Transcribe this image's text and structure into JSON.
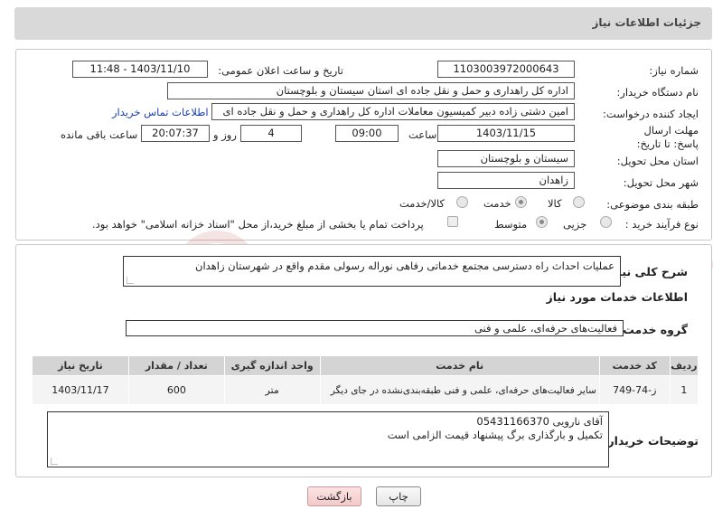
{
  "header": {
    "title": "جزئیات اطلاعات نیاز"
  },
  "form": {
    "need_number": {
      "label": "شماره نیاز:",
      "value": "1103003972000643"
    },
    "announce_datetime": {
      "label": "تاریخ و ساعت اعلان عمومی:",
      "value": "1403/11/10 - 11:48"
    },
    "buyer_org": {
      "label": "نام دستگاه خریدار:",
      "value": "اداره کل راهداری و حمل و نقل جاده ای استان سیستان و بلوچستان"
    },
    "requester": {
      "label": "ایجاد کننده درخواست:",
      "value": "امین دشتی زاده دبیر کمیسیون معاملات اداره کل راهداری و حمل و نقل جاده ای",
      "contact_link": "اطلاعات تماس خریدار"
    },
    "deadline": {
      "label": "مهلت ارسال پاسخ: تا تاریخ:",
      "date": "1403/11/15",
      "time_label": "ساعت",
      "time": "09:00",
      "days": "4",
      "days_label": "روز و",
      "remaining": "20:07:37",
      "remaining_label": "ساعت باقی مانده"
    },
    "province": {
      "label": "استان محل تحویل:",
      "value": "سیستان و بلوچستان"
    },
    "city": {
      "label": "شهر محل تحویل:",
      "value": "زاهدان"
    },
    "category": {
      "label": "طبقه بندی موضوعی:",
      "options": [
        "کالا",
        "خدمت",
        "کالا/خدمت"
      ],
      "selected": "خدمت"
    },
    "process_type": {
      "label": "نوع فرآیند خرید :",
      "options": [
        "جزیی",
        "متوسط"
      ],
      "selected": "متوسط",
      "treasury_note": "پرداخت تمام یا بخشی از مبلغ خرید،از محل \"اسناد خزانه اسلامی\" خواهد بود."
    }
  },
  "summary": {
    "label": "شرح کلی نیاز:",
    "value": "عملیات احداث راه دسترسی مجتمع خدماتی رفاهی نوراله رسولی مقدم واقع در شهرستان زاهدان"
  },
  "services": {
    "section_title": "اطلاعات خدمات مورد نیاز",
    "group_label": "گروه خدمت:",
    "group_value": "فعالیت‌های حرفه‌ای، علمی و فنی",
    "table": {
      "headers": [
        "ردیف",
        "کد خدمت",
        "نام خدمت",
        "واحد اندازه گیری",
        "تعداد / مقدار",
        "تاریخ نیاز"
      ],
      "rows": [
        [
          "1",
          "ز-74-749",
          "سایر فعالیت‌های حرفه‌ای، علمی و فنی طبقه‌بندی‌نشده در جای دیگر",
          "متر",
          "600",
          "1403/11/17"
        ]
      ]
    }
  },
  "buyer_notes": {
    "label": "توضیحات خریدار:",
    "line1": "آقای نارویی 05431166370",
    "line2": "تکمیل و بارگذاری برگ پیشنهاد قیمت الزامی است"
  },
  "buttons": {
    "print": "چاپ",
    "back": "بازگشت"
  },
  "watermark": {
    "text": "AriaTender.neT"
  }
}
